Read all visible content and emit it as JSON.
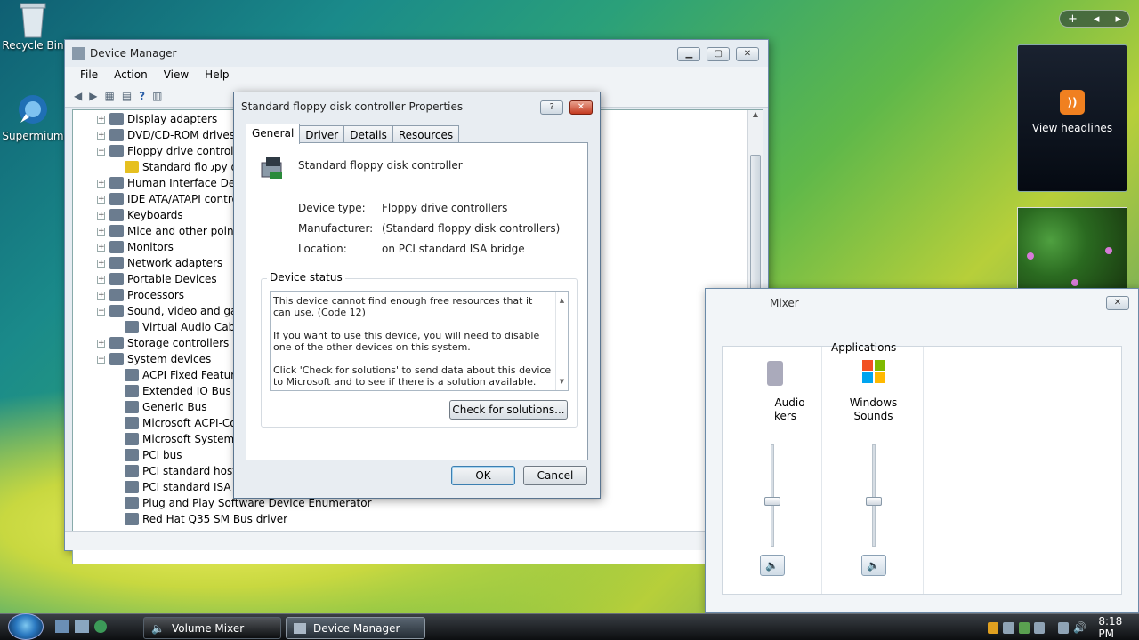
{
  "desktop": {
    "icons": [
      {
        "label": "Recycle Bin",
        "icon": "recycle-bin-icon"
      },
      {
        "label": "Supermium",
        "icon": "supermium-icon"
      }
    ],
    "gadgets": {
      "news_label": "View headlines",
      "sidebar_add": "+",
      "sidebar_prev": "◂",
      "sidebar_next": "▸"
    }
  },
  "device_manager": {
    "title": "Device Manager",
    "menu": [
      "File",
      "Action",
      "View",
      "Help"
    ],
    "tree": [
      {
        "label": "Display adapters",
        "exp": "+",
        "indent": 0
      },
      {
        "label": "DVD/CD-ROM drives",
        "exp": "+",
        "indent": 0
      },
      {
        "label": "Floppy drive controllers",
        "exp": "-",
        "indent": 0
      },
      {
        "label": "Standard floppy disk controller",
        "exp": "",
        "indent": 1,
        "warning": true
      },
      {
        "label": "Human Interface Devices",
        "exp": "+",
        "indent": 0
      },
      {
        "label": "IDE ATA/ATAPI controllers",
        "exp": "+",
        "indent": 0
      },
      {
        "label": "Keyboards",
        "exp": "+",
        "indent": 0
      },
      {
        "label": "Mice and other pointing devices",
        "exp": "+",
        "indent": 0
      },
      {
        "label": "Monitors",
        "exp": "+",
        "indent": 0
      },
      {
        "label": "Network adapters",
        "exp": "+",
        "indent": 0
      },
      {
        "label": "Portable Devices",
        "exp": "+",
        "indent": 0
      },
      {
        "label": "Processors",
        "exp": "+",
        "indent": 0
      },
      {
        "label": "Sound, video and game controllers",
        "exp": "-",
        "indent": 0
      },
      {
        "label": "Virtual Audio Cable",
        "exp": "",
        "indent": 1
      },
      {
        "label": "Storage controllers",
        "exp": "+",
        "indent": 0
      },
      {
        "label": "System devices",
        "exp": "-",
        "indent": 0
      },
      {
        "label": "ACPI Fixed Feature Button",
        "exp": "",
        "indent": 1
      },
      {
        "label": "Extended IO Bus",
        "exp": "",
        "indent": 1
      },
      {
        "label": "Generic Bus",
        "exp": "",
        "indent": 1
      },
      {
        "label": "Microsoft ACPI-Compliant System",
        "exp": "",
        "indent": 1
      },
      {
        "label": "Microsoft System Management BIOS Driver",
        "exp": "",
        "indent": 1
      },
      {
        "label": "PCI bus",
        "exp": "",
        "indent": 1
      },
      {
        "label": "PCI standard host CPU bridge",
        "exp": "",
        "indent": 1
      },
      {
        "label": "PCI standard ISA bridge",
        "exp": "",
        "indent": 1
      },
      {
        "label": "Plug and Play Software Device Enumerator",
        "exp": "",
        "indent": 1
      },
      {
        "label": "Red Hat Q35 SM Bus driver",
        "exp": "",
        "indent": 1
      }
    ]
  },
  "properties": {
    "title": "Standard floppy disk controller Properties",
    "help_btn": "?",
    "close_btn": "✕",
    "tabs": [
      "General",
      "Driver",
      "Details",
      "Resources"
    ],
    "device_name": "Standard floppy disk controller",
    "fields": [
      {
        "label": "Device type:",
        "value": "Floppy drive controllers"
      },
      {
        "label": "Manufacturer:",
        "value": "(Standard floppy disk controllers)"
      },
      {
        "label": "Location:",
        "value": "on PCI standard ISA bridge"
      }
    ],
    "status_legend": "Device status",
    "status_paragraphs": [
      "This device cannot find enough free resources that it can use. (Code 12)",
      "If you want to use this device, you will need to disable one of the other devices on this system.",
      "Click 'Check for solutions' to send data about this device to Microsoft and to see if there is a solution available."
    ],
    "check_btn": "Check for solutions...",
    "ok_btn": "OK",
    "cancel_btn": "Cancel"
  },
  "volume_mixer": {
    "title": "Mixer",
    "close_btn": "✕",
    "applications_label": "Applications",
    "device_name_line1": "Audio",
    "device_name_line2": "kers",
    "app_name_line1": "Windows",
    "app_name_line2": "Sounds",
    "device_level": 0.45,
    "app_level": 0.45
  },
  "taskbar": {
    "buttons": [
      {
        "label": "Volume Mixer",
        "icon": "speaker-icon"
      },
      {
        "label": "Device Manager",
        "icon": "device-manager-icon"
      }
    ],
    "clock": "8:18 PM"
  }
}
